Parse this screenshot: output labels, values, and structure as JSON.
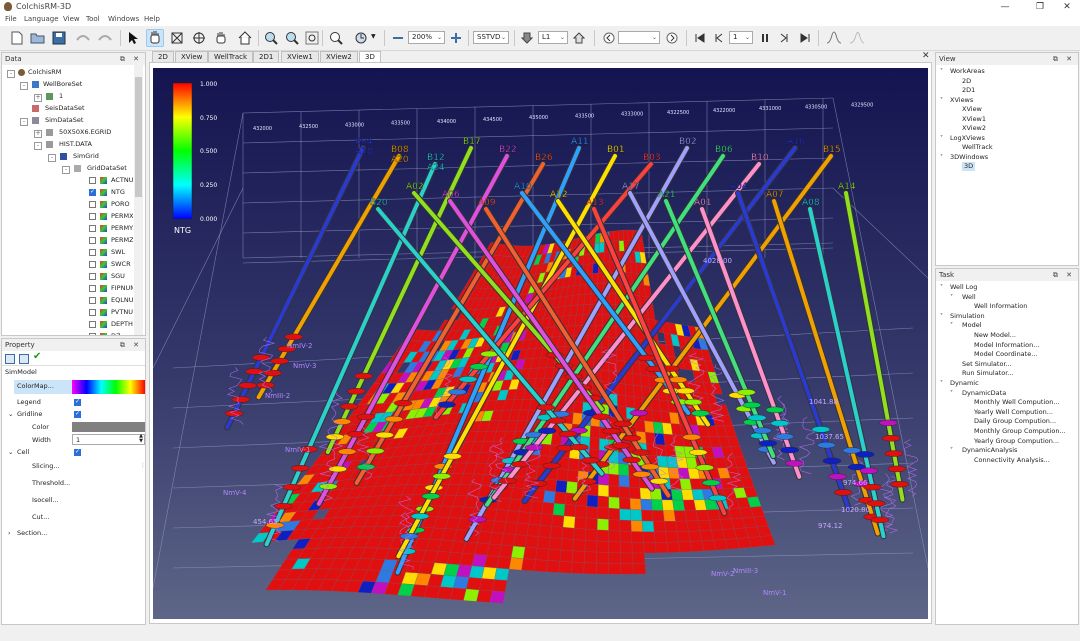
{
  "window": {
    "title": "ColchisRM-3D"
  },
  "menu": [
    "File",
    "Language",
    "View",
    "Tool",
    "Windows",
    "Help"
  ],
  "toolbar": {
    "zoom_value": "200%",
    "depth_mode": "SSTVD",
    "layer_value": "L1",
    "time_value": "",
    "step_value": "1"
  },
  "tabs": [
    "2D",
    "XView",
    "WellTrack",
    "2D1",
    "XView1",
    "XView2",
    "3D"
  ],
  "active_tab": "3D",
  "data_panel": {
    "title": "Data",
    "tree": [
      {
        "label": "ColchisRM",
        "level": 0,
        "expanded": true
      },
      {
        "label": "WellBoreSet",
        "level": 1,
        "expanded": true
      },
      {
        "label": "1",
        "level": 2,
        "expanded": false
      },
      {
        "label": "SeisDataSet",
        "level": 1
      },
      {
        "label": "SimDataSet",
        "level": 1,
        "expanded": true
      },
      {
        "label": "50X50X6.EGRID",
        "level": 2,
        "expanded": false
      },
      {
        "label": "HIST.DATA",
        "level": 2,
        "expanded": true
      },
      {
        "label": "SimGrid",
        "level": 3,
        "expanded": true
      },
      {
        "label": "GridDataSet",
        "level": 4,
        "expanded": true
      }
    ],
    "grid_props": [
      {
        "label": "ACTNUM",
        "checked": false
      },
      {
        "label": "NTG",
        "checked": true
      },
      {
        "label": "PORO",
        "checked": false
      },
      {
        "label": "PERMX",
        "checked": false
      },
      {
        "label": "PERMY",
        "checked": false
      },
      {
        "label": "PERMZ",
        "checked": false
      },
      {
        "label": "SWL",
        "checked": false
      },
      {
        "label": "SWCR",
        "checked": false
      },
      {
        "label": "SGU",
        "checked": false
      },
      {
        "label": "FIPNUM",
        "checked": false
      },
      {
        "label": "EQLNUM",
        "checked": false
      },
      {
        "label": "PVTNUM",
        "checked": false
      },
      {
        "label": "DEPTH",
        "checked": false
      },
      {
        "label": "DZ",
        "checked": false
      }
    ]
  },
  "property_panel": {
    "title": "Property",
    "object": "SimModel",
    "rows": {
      "colormap": "ColorMap...",
      "legend": "Legend",
      "gridline": "Gridline",
      "color": "Color",
      "width": "Width",
      "width_value": "1",
      "cell": "Cell",
      "slicing": "Slicing...",
      "threshold": "Threshold...",
      "isocell": "Isocell...",
      "cut": "Cut...",
      "section": "Section..."
    },
    "legend_checked": true,
    "gridline_checked": true,
    "cell_checked": true
  },
  "view_panel": {
    "title": "View",
    "tree": [
      {
        "label": "WorkAreas",
        "level": 0
      },
      {
        "label": "2D",
        "level": 1
      },
      {
        "label": "2D1",
        "level": 1
      },
      {
        "label": "XViews",
        "level": 0
      },
      {
        "label": "XView",
        "level": 1
      },
      {
        "label": "XView1",
        "level": 1
      },
      {
        "label": "XView2",
        "level": 1
      },
      {
        "label": "LogXViews",
        "level": 0
      },
      {
        "label": "WellTrack",
        "level": 1
      },
      {
        "label": "3DWindows",
        "level": 0
      },
      {
        "label": "3D",
        "level": 1,
        "selected": true
      }
    ]
  },
  "task_panel": {
    "title": "Task",
    "tree": [
      {
        "label": "Well Log",
        "level": 0
      },
      {
        "label": "Well",
        "level": 1
      },
      {
        "label": "Well Information",
        "level": 2
      },
      {
        "label": "Simulation",
        "level": 0
      },
      {
        "label": "Model",
        "level": 1
      },
      {
        "label": "New Model...",
        "level": 2
      },
      {
        "label": "Model Information...",
        "level": 2
      },
      {
        "label": "Model Coordinate...",
        "level": 2
      },
      {
        "label": "Set Simulator...",
        "level": 1
      },
      {
        "label": "Run Simulator...",
        "level": 1
      },
      {
        "label": "Dynamic",
        "level": 0
      },
      {
        "label": "DynamicData",
        "level": 1
      },
      {
        "label": "Monthly Well Compution...",
        "level": 2
      },
      {
        "label": "Yearly Well Compution...",
        "level": 2
      },
      {
        "label": "Daily Group Compution...",
        "level": 2
      },
      {
        "label": "Monthly Group Compution...",
        "level": 2
      },
      {
        "label": "Yearly Group Compution...",
        "level": 2
      },
      {
        "label": "DynamicAnalysis",
        "level": 1
      },
      {
        "label": "Connectivity Analysis...",
        "level": 2
      }
    ]
  },
  "scene": {
    "legend_title": "NTG",
    "legend_ticks": [
      "1.000",
      "0.750",
      "0.500",
      "0.250",
      "0.000"
    ],
    "axis_labels": [
      "432000",
      "432500",
      "433000",
      "433500",
      "434000",
      "434500",
      "435000",
      "433500",
      "4333000",
      "4322500",
      "4322000",
      "4331000",
      "4330500",
      "4329500"
    ],
    "well_names": [
      "B04",
      "B08",
      "B12",
      "B17",
      "B22",
      "B26",
      "A11",
      "B01",
      "B03",
      "B02",
      "B06",
      "B10",
      "A16",
      "B15",
      "B20",
      "A02",
      "A06",
      "A09",
      "A10",
      "A12",
      "A13",
      "A17",
      "A21",
      "A01",
      "A04",
      "A07",
      "A08",
      "A14",
      "A18",
      "A20",
      "A24"
    ],
    "log_labels": [
      "NmV-2",
      "NmV-4",
      "NmIV-2",
      "NmIII-2",
      "NmV-1",
      "NmIV-1",
      "NmV-3",
      "NmIII-3"
    ],
    "depth_labels": [
      "974.66",
      "1041.88",
      "1037.65",
      "454.65",
      "1020.80",
      "974.12",
      "4028.00"
    ],
    "colors": {
      "background_top": "#141450",
      "background_bottom": "#5e6688",
      "ntg_high": "#e01010"
    }
  }
}
